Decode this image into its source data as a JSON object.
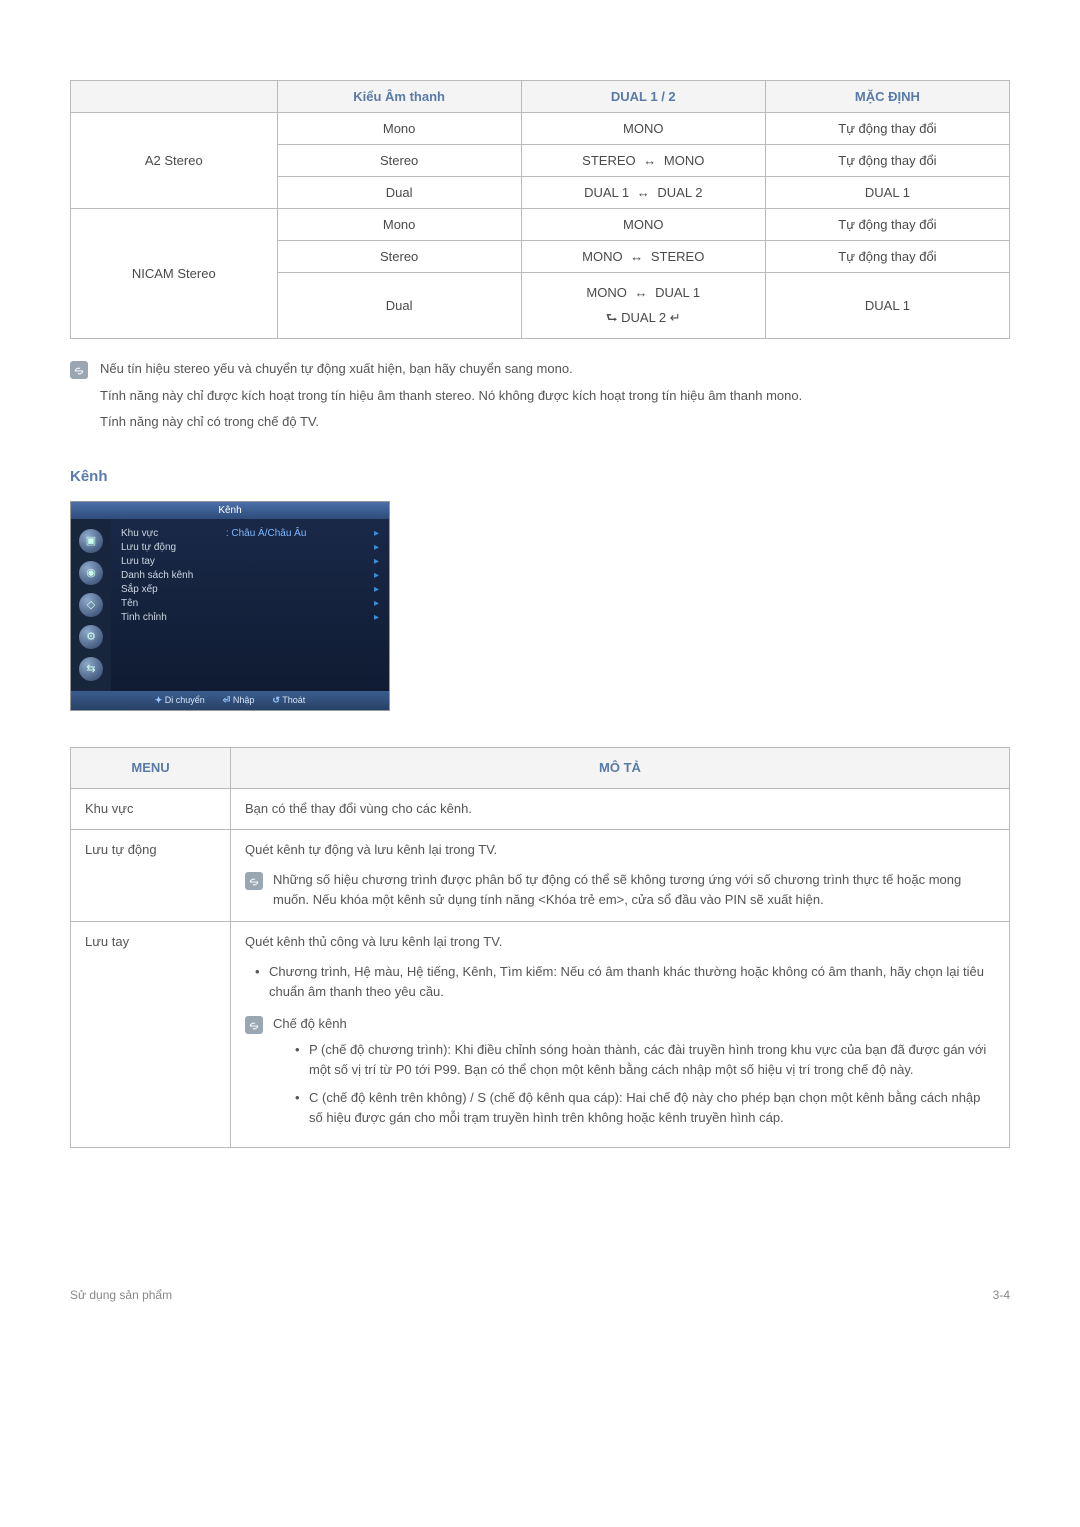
{
  "table1": {
    "headers": {
      "blank": "",
      "col1": "Kiểu Âm thanh",
      "col2": "DUAL 1 / 2",
      "col3": "MẶC ĐỊNH"
    },
    "groups": [
      {
        "system": "A2 Stereo",
        "rows": [
          {
            "type": "Mono",
            "dual_pre": "",
            "dual_post": "MONO",
            "arrow": "none",
            "def": "Tự động thay đổi"
          },
          {
            "type": "Stereo",
            "dual_pre": "STEREO",
            "dual_post": "MONO",
            "arrow": "lr",
            "def": "Tự động thay đổi"
          },
          {
            "type": "Dual",
            "dual_pre": "DUAL 1",
            "dual_post": "DUAL 2",
            "arrow": "lr",
            "def": "DUAL 1"
          }
        ]
      },
      {
        "system": "NICAM Stereo",
        "rows": [
          {
            "type": "Mono",
            "dual_pre": "",
            "dual_post": "MONO",
            "arrow": "none",
            "def": "Tự động thay đổi"
          },
          {
            "type": "Stereo",
            "dual_pre": "MONO",
            "dual_post": "STEREO",
            "arrow": "lr",
            "def": "Tự động thay đổi"
          },
          {
            "type": "Dual",
            "line1_pre": "MONO",
            "line1_post": "DUAL 1",
            "line2": "DUAL 2",
            "arrow": "multi",
            "def": "DUAL 1"
          }
        ]
      }
    ]
  },
  "notes": {
    "n1": "Nếu tín hiệu stereo yếu và chuyển tự động xuất hiện, bạn hãy chuyển sang mono.",
    "n2": "Tính năng này chỉ được kích hoạt trong tín hiệu âm thanh stereo. Nó không được kích hoạt trong tín hiệu âm thanh mono.",
    "n3": "Tính năng này chỉ có trong chế độ TV."
  },
  "section_title": "Kênh",
  "osd": {
    "title": "Kênh",
    "items": [
      {
        "label": "Khu vực",
        "value": ": Châu Á/Châu Âu",
        "arrow": true
      },
      {
        "label": "Lưu tự động",
        "value": "",
        "arrow": true
      },
      {
        "label": "Lưu tay",
        "value": "",
        "arrow": true
      },
      {
        "label": "Danh sách kênh",
        "value": "",
        "arrow": true
      },
      {
        "label": "Sắp xếp",
        "value": "",
        "arrow": true
      },
      {
        "label": "Tên",
        "value": "",
        "arrow": true
      },
      {
        "label": "Tinh chỉnh",
        "value": "",
        "arrow": true
      }
    ],
    "footer": {
      "move": "Di chuyển",
      "enter": "Nhập",
      "exit": "Thoát"
    }
  },
  "desc": {
    "headers": {
      "menu": "MENU",
      "desc": "MÔ TẢ"
    },
    "rows": [
      {
        "menu": "Khu vực",
        "body": "Bạn có thể thay đổi vùng cho các kênh."
      },
      {
        "menu": "Lưu tự động",
        "body": "Quét kênh tự động và lưu kênh lại trong TV.",
        "note": "Những số hiệu chương trình được phân bố tự động có thể sẽ không tương ứng với số chương trình thực tế hoặc mong muốn. Nếu khóa một kênh sử dụng tính năng <Khóa trẻ em>, cửa sổ đầu vào PIN sẽ xuất hiện."
      },
      {
        "menu": "Lưu tay",
        "body": "Quét kênh thủ công và lưu kênh lại trong TV.",
        "bullets": [
          "Chương trình, Hệ màu, Hệ tiếng, Kênh, Tìm kiếm: Nếu có âm thanh khác thường hoặc không có âm thanh, hãy chọn lại tiêu chuẩn âm thanh theo yêu cầu."
        ],
        "sub_note_title": "Chế độ kênh",
        "sub_bullets": [
          "P (chế độ chương trình): Khi điều chỉnh sóng hoàn thành, các đài truyền hình trong khu vực của bạn đã được gán với một số vị trí từ P0 tới P99. Bạn có thể chọn một kênh bằng cách nhập một số hiệu vị trí trong chế độ này.",
          "C (chế độ kênh trên không) / S (chế độ kênh qua cáp): Hai chế độ này cho phép bạn chọn một kênh bằng cách nhập số hiệu được gán cho mỗi trạm truyền hình trên không hoặc kênh truyền hình cáp."
        ]
      }
    ]
  },
  "footer": {
    "left": "Sử dụng sản phẩm",
    "right": "3-4"
  }
}
